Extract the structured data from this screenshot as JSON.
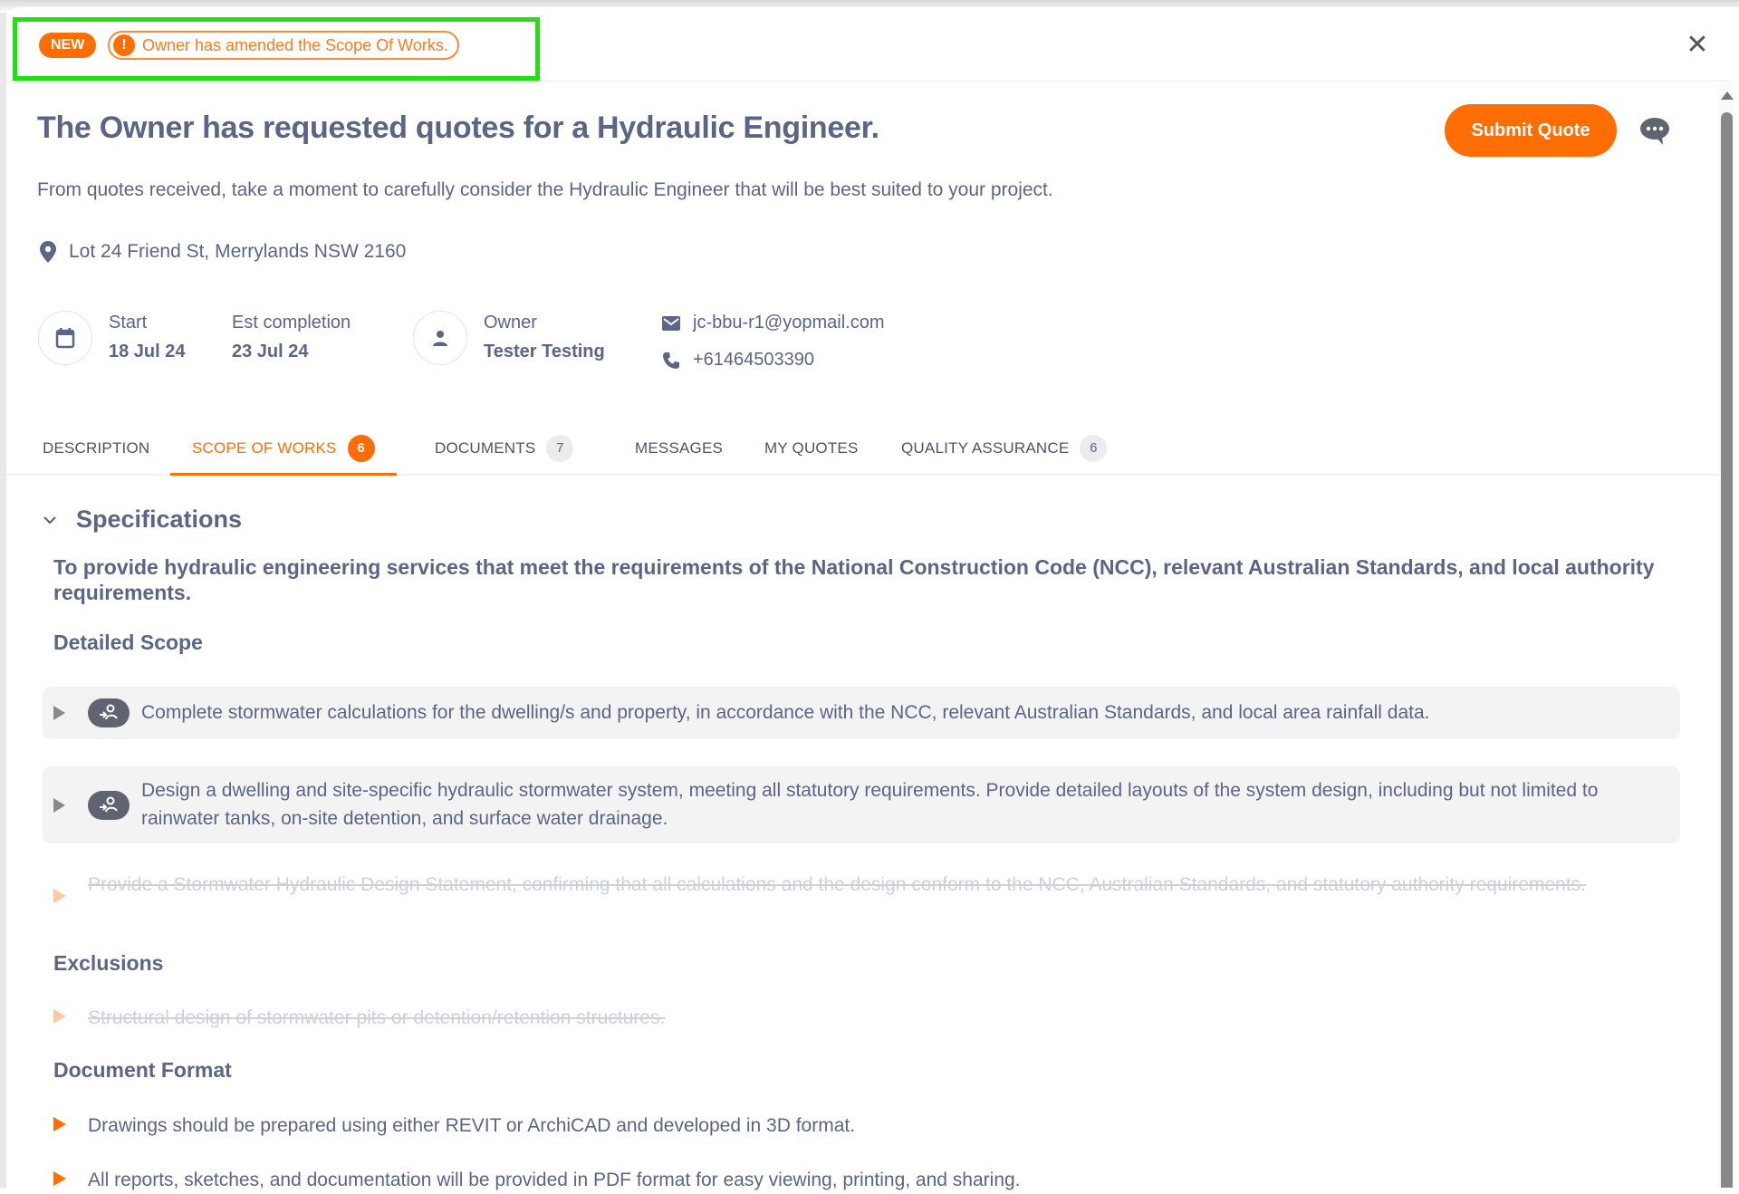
{
  "banner": {
    "new_badge": "NEW",
    "notice_icon": "exclamation-icon",
    "notice_text": "Owner has amended the Scope Of Works.",
    "close_icon": "close-icon"
  },
  "header": {
    "title": "The Owner has requested quotes for a Hydraulic Engineer.",
    "subtitle": "From quotes received, take a moment to carefully consider the Hydraulic Engineer that will be best suited to your project.",
    "submit_label": "Submit Quote",
    "chat_icon": "chat-bubble-icon",
    "location": "Lot 24 Friend St, Merrylands NSW 2160"
  },
  "info": {
    "start_label": "Start",
    "start_value": "18 Jul 24",
    "completion_label": "Est completion",
    "completion_value": "23 Jul 24",
    "owner_label": "Owner",
    "owner_value": "Tester Testing",
    "email": "jc-bbu-r1@yopmail.com",
    "phone": "+61464503390"
  },
  "tabs": [
    {
      "label": "DESCRIPTION",
      "count": null,
      "active": false
    },
    {
      "label": "SCOPE OF WORKS",
      "count": "6",
      "active": true
    },
    {
      "label": "DOCUMENTS",
      "count": "7",
      "active": false
    },
    {
      "label": "MESSAGES",
      "count": null,
      "active": false
    },
    {
      "label": "MY QUOTES",
      "count": null,
      "active": false
    },
    {
      "label": "QUALITY ASSURANCE",
      "count": "6",
      "active": false
    }
  ],
  "content": {
    "section_title": "Specifications",
    "intro": "To provide hydraulic engineering services that meet the requirements of the National Construction Code (NCC), relevant Australian Standards, and local authority requirements.",
    "detailed_scope_heading": "Detailed Scope",
    "detailed_scope_items": [
      {
        "text": "Complete stormwater calculations for the dwelling/s and property, in accordance with the NCC, relevant Australian Standards, and local area rainfall data.",
        "state": "assigned"
      },
      {
        "text": "Design a dwelling and site-specific hydraulic stormwater system, meeting all statutory requirements. Provide detailed layouts of the system design, including but not limited to rainwater tanks, on-site detention, and surface water drainage.",
        "state": "assigned"
      },
      {
        "text": "Provide a Stormwater Hydraulic Design Statement, confirming that all calculations and the design conform to the NCC, Australian Standards, and statutory authority requirements.",
        "state": "removed"
      }
    ],
    "exclusions_heading": "Exclusions",
    "exclusions_items": [
      {
        "text": "Structural design of stormwater pits or detention/retention structures.",
        "state": "removed"
      }
    ],
    "document_format_heading": "Document Format",
    "document_format_items": [
      {
        "text": "Drawings should be prepared using either REVIT or ArchiCAD and developed in 3D format.",
        "state": "active"
      },
      {
        "text": "All reports, sketches, and documentation will be provided in PDF format for easy viewing, printing, and sharing.",
        "state": "active"
      }
    ]
  },
  "colors": {
    "accent": "#ff6d05",
    "text": "#5b6585",
    "highlight": "#22e010",
    "struck_text": "#ccd0db"
  }
}
